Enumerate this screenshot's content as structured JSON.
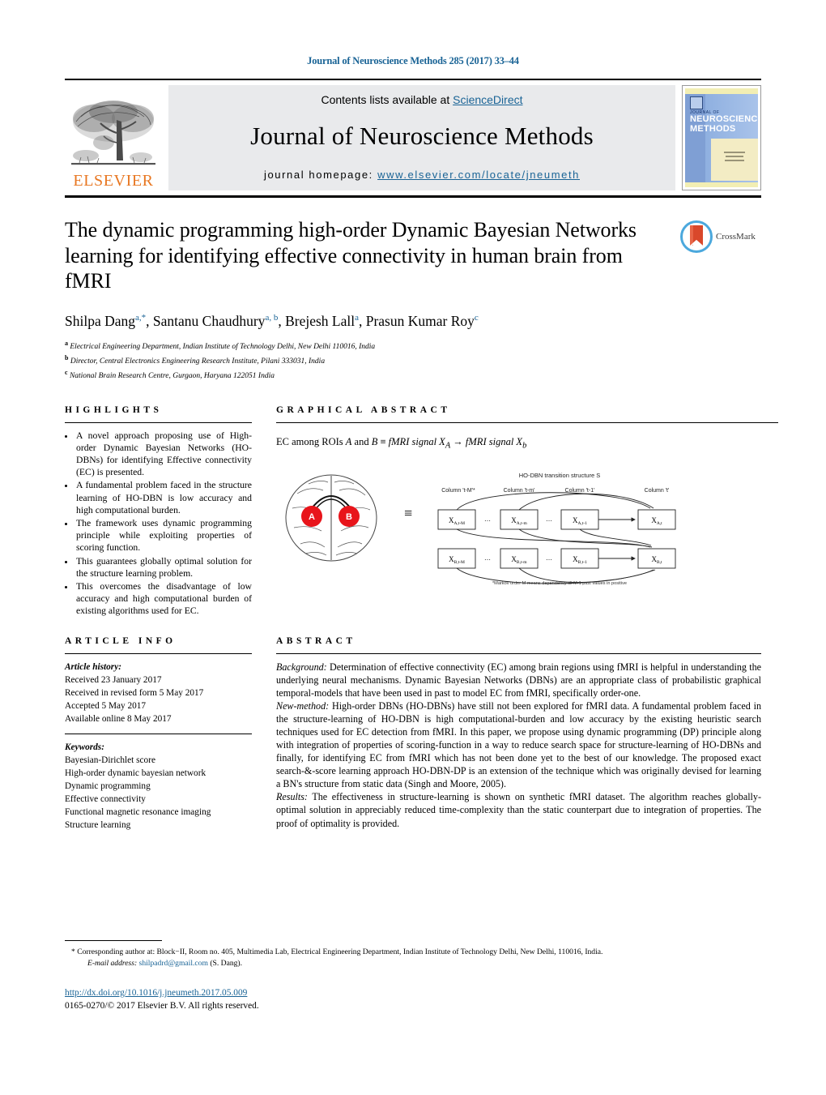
{
  "running_head": "Journal of Neuroscience Methods 285 (2017) 33–44",
  "masthead": {
    "contents_prefix": "Contents lists available at ",
    "sciencedirect": "ScienceDirect",
    "journal_title": "Journal of Neuroscience Methods",
    "homepage_prefix": "journal homepage: ",
    "homepage_url": "www.elsevier.com/locate/jneumeth",
    "publisher_logo_text": "ELSEVIER",
    "cover": {
      "line1": "JOURNAL OF",
      "line2": "NEUROSCIENCE",
      "line3": "METHODS"
    }
  },
  "crossmark": {
    "label": "CrossMark"
  },
  "article": {
    "title": "The dynamic programming high-order Dynamic Bayesian Networks learning for identifying effective connectivity in human brain from fMRI",
    "authors": [
      {
        "name": "Shilpa Dang",
        "sup": "a,",
        "star": "*"
      },
      {
        "name": "Santanu Chaudhury",
        "sup": "a, b"
      },
      {
        "name": "Brejesh Lall",
        "sup": "a"
      },
      {
        "name": "Prasun Kumar Roy",
        "sup": "c"
      }
    ],
    "affiliations": [
      {
        "mark": "a",
        "text": "Electrical Engineering Department, Indian Institute of Technology Delhi, New Delhi 110016, India"
      },
      {
        "mark": "b",
        "text": "Director, Central Electronics Engineering Research Institute, Pilani 333031, India"
      },
      {
        "mark": "c",
        "text": "National Brain Research Centre, Gurgaon, Haryana 122051 India"
      }
    ]
  },
  "highlights": {
    "heading": "HIGHLIGHTS",
    "items": [
      "A novel approach proposing use of High-order Dynamic Bayesian Networks (HO-DBNs) for identifying Effective connectivity (EC) is presented.",
      "A fundamental problem faced in the structure learning of HO-DBN is low accuracy and high computational burden.",
      "The framework uses dynamic programming principle while exploiting properties of scoring function.",
      "This guarantees globally optimal solution for the structure learning problem.",
      "This overcomes the disadvantage of low accuracy and high computational burden of existing algorithms used for EC."
    ]
  },
  "graphical_abstract": {
    "heading": "GRAPHICAL ABSTRACT",
    "equation_prefix": "EC among ROIs ",
    "equation_roi_a": "A",
    "equation_and": " and ",
    "equation_roi_b": "B",
    "equation_equiv": " ≡ ",
    "equation_signal_a": "fMRI signal X",
    "equation_sub_a": "A",
    "equation_arrow": " → ",
    "equation_signal_b": "fMRI signal X",
    "equation_sub_b": "b",
    "diagram_title": "HO-DBN transition structure S",
    "column_labels": [
      "Column 't-M'*",
      "Column 't-m'",
      "Column 't-1'",
      "Column 't'"
    ],
    "brain_nodes": [
      "A",
      "B"
    ],
    "equals_sign": "≡",
    "row_a_nodes": [
      "X",
      "X",
      "X",
      "X"
    ],
    "row_a_subs": [
      "A,t-M",
      "A,t-m",
      "A,t-1",
      "A,t"
    ],
    "row_b_nodes": [
      "X",
      "X",
      "X",
      "X"
    ],
    "row_b_subs": [
      "B,t-M",
      "B,t-m",
      "B,t-1",
      "B,t"
    ],
    "ellipsis": "...",
    "footnote": "*Markov order M means dependency till M-1 past values in positive"
  },
  "article_info": {
    "heading": "ARTICLE INFO",
    "history_label": "Article history:",
    "history": [
      "Received 23 January 2017",
      "Received in revised form 5 May 2017",
      "Accepted 5 May 2017",
      "Available online 8 May 2017"
    ],
    "keywords_label": "Keywords:",
    "keywords": [
      "Bayesian-Dirichlet score",
      "High-order dynamic bayesian network",
      "Dynamic programming",
      "Effective connectivity",
      "Functional magnetic resonance imaging",
      "Structure learning"
    ]
  },
  "abstract": {
    "heading": "ABSTRACT",
    "sections": [
      {
        "label": "Background:",
        "text": " Determination of effective connectivity (EC) among brain regions using fMRI is helpful in understanding the underlying neural mechanisms. Dynamic Bayesian Networks (DBNs) are an appropriate class of probabilistic graphical temporal-models that have been used in past to model EC from fMRI, specifically order-one."
      },
      {
        "label": "New-method:",
        "text": " High-order DBNs (HO-DBNs) have still not been explored for fMRI data. A fundamental problem faced in the structure-learning of HO-DBN is high computational-burden and low accuracy by the existing heuristic search techniques used for EC detection from fMRI. In this paper, we propose using dynamic programming (DP) principle along with integration of properties of scoring-function in a way to reduce search space for structure-learning of HO-DBNs and finally, for identifying EC from fMRI which has not been done yet to the best of our knowledge. The proposed exact search-&-score learning approach HO-DBN-DP is an extension of the technique which was originally devised for learning a BN's structure from static data (Singh and Moore, 2005)."
      },
      {
        "label": "Results:",
        "text": " The effectiveness in structure-learning is shown on synthetic fMRI dataset. The algorithm reaches globally-optimal solution in appreciably reduced time-complexity than the static counterpart due to integration of properties. The proof of optimality is provided."
      }
    ]
  },
  "footer": {
    "corresponding_marker": "*",
    "corresponding_text": " Corresponding author at: Block−II, Room no. 405, Multimedia Lab, Electrical Engineering Department, Indian Institute of Technology Delhi, New Delhi, 110016, India.",
    "email_label": "E-mail address:",
    "email": "shilpadrd@gmail.com",
    "email_suffix": " (S. Dang).",
    "doi": "http://dx.doi.org/10.1016/j.jneumeth.2017.05.009",
    "copyright": "0165-0270/© 2017 Elsevier B.V. All rights reserved."
  },
  "colors": {
    "link": "#1a6496",
    "elsevier_orange": "#e87722",
    "brain_node": "#e8151b",
    "masthead_bg": "#e9eaec"
  }
}
